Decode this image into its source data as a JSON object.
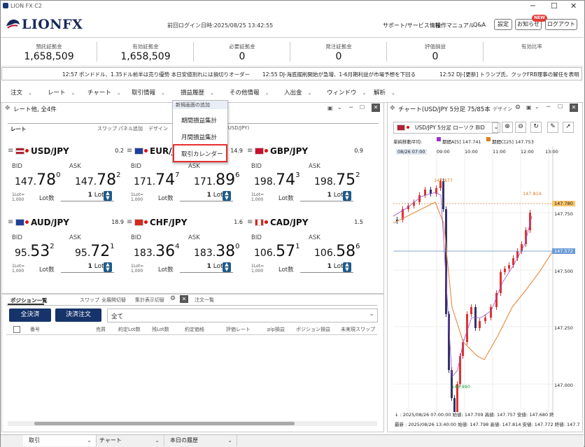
{
  "window": {
    "title": "LION FX C2",
    "min": "─",
    "max": "☐",
    "close": "✕"
  },
  "header": {
    "logo": "LIONFX",
    "last_login": "前回ログイン日時:2025/08/25 13:42:55",
    "links": [
      "サポート/サービス情報",
      "操作マニュアル",
      "Q&A"
    ],
    "buttons": [
      "設定",
      "お知らせ",
      "ログアウト"
    ],
    "new_badge": "NEW"
  },
  "summary": [
    {
      "label": "預託証拠金",
      "value": "1,658,509"
    },
    {
      "label": "有効証拠金",
      "value": "1,658,509"
    },
    {
      "label": "必要証拠金",
      "value": "0"
    },
    {
      "label": "発注証拠金",
      "value": "0"
    },
    {
      "label": "評価損益",
      "value": "0"
    },
    {
      "label": "有効比率",
      "value": ""
    }
  ],
  "ticker": [
    "12:57  ポンドドル、1.35ドル前半は売り優勢  本日安値割れには損切りオーダー",
    "12:55  DJ-海底掘削開始が急増、1-6月期利益が市場予想を下回る",
    "12:52  DJ-[更新] トランプ氏、クックFRB理事の解任を表明"
  ],
  "menu": [
    {
      "label": "注文"
    },
    {
      "label": "レート"
    },
    {
      "label": "チャート"
    },
    {
      "label": "取引情報"
    },
    {
      "label": "損益履歴"
    },
    {
      "label": "その他情報"
    },
    {
      "label": "入出金"
    },
    {
      "label": "ウィンドウ"
    },
    {
      "label": "解析"
    }
  ],
  "dropdown": {
    "header": "新規画面の追加",
    "items": [
      "期間損益集計",
      "月間損益集計",
      "取引カレンダー"
    ]
  },
  "rate_panel": {
    "title": "レート他, 全4件",
    "tab": "レート",
    "subtabs": [
      "スワップ",
      "パネル追加",
      "デザイン"
    ],
    "extra": "(USD/JPY)"
  },
  "pairs": [
    {
      "name": "USD/JPY",
      "spread": "0.2",
      "bid_head": "147.",
      "bid_big": "78",
      "bid_sup": "0",
      "ask_head": "147.",
      "ask_big": "78",
      "ask_sup": "2",
      "flag": "us"
    },
    {
      "name": "EUR/JPY",
      "spread": "14.9",
      "bid_head": "171.",
      "bid_big": "74",
      "bid_sup": "7",
      "ask_head": "171.",
      "ask_big": "89",
      "ask_sup": "6",
      "flag": "eu"
    },
    {
      "name": "GBP/JPY",
      "spread": "0.9",
      "bid_head": "198.",
      "bid_big": "74",
      "bid_sup": "3",
      "ask_head": "198.",
      "ask_big": "75",
      "ask_sup": "2",
      "flag": "gb"
    },
    {
      "name": "AUD/JPY",
      "spread": "18.9",
      "bid_head": "95.",
      "bid_big": "53",
      "bid_sup": "2",
      "ask_head": "95.",
      "ask_big": "72",
      "ask_sup": "1",
      "flag": "au"
    },
    {
      "name": "CHF/JPY",
      "spread": "1.6",
      "bid_head": "183.",
      "bid_big": "36",
      "bid_sup": "4",
      "ask_head": "183.",
      "ask_big": "38",
      "ask_sup": "0",
      "flag": "ch"
    },
    {
      "name": "CAD/JPY",
      "spread": "1.5",
      "bid_head": "106.",
      "bid_big": "57",
      "bid_sup": "1",
      "ask_head": "106.",
      "ask_big": "58",
      "ask_sup": "6",
      "flag": "ca"
    }
  ],
  "labels": {
    "bid": "BID",
    "ask": "ASK",
    "lot_line1": "1Lot=",
    "lot_line2": "1,000",
    "lot": "Lot数",
    "lot_value": "1",
    "lot_unit": "Lot"
  },
  "position": {
    "title": "ポジション一覧",
    "tabs": [
      "スワップ",
      "全展開切替",
      "集計表示切替"
    ],
    "other_tab": "注文一覧",
    "btn_close_all": "全決済",
    "btn_close_order": "決済注文",
    "filter": "全て",
    "columns": [
      "番号",
      "売買",
      "約定Lot数",
      "残Lot数",
      "約定価格",
      "評価レート",
      "pip損益",
      "ポジション損益",
      "未実現スワップ"
    ]
  },
  "chart": {
    "title": "チャート(USD/JPY 5分足 75/85本",
    "design": "デザイン",
    "symbol": "USD/JPY 5分足 ローソク BID",
    "ma_label": "単純移動平均:",
    "ma1": "期間A[5] 147.741",
    "ma2": "期間C[25] 147.753",
    "times": [
      "08/26 07:00",
      "09:00",
      "10:00",
      "11:00",
      "12:00",
      "13:00"
    ],
    "yticks": [
      "147.750",
      "147.500",
      "147.250",
      "147.000"
    ],
    "tag_current": "147.780",
    "tag_ma": "147.572",
    "high1": "147.877",
    "high2": "147.814",
    "low": "146.990",
    "footer1": "↓ : 2025/08/26 07:00:00  始値: 147.709  高値: 147.757  安値: 147.680  終",
    "footer2": "最新 : 2025/08/26 13:40:00  始値: 147.798  高値: 147.814  安値: 147.772  終値: 147.7"
  },
  "bottom_tabs": [
    "取引",
    "チャート",
    "本日の履歴"
  ]
}
